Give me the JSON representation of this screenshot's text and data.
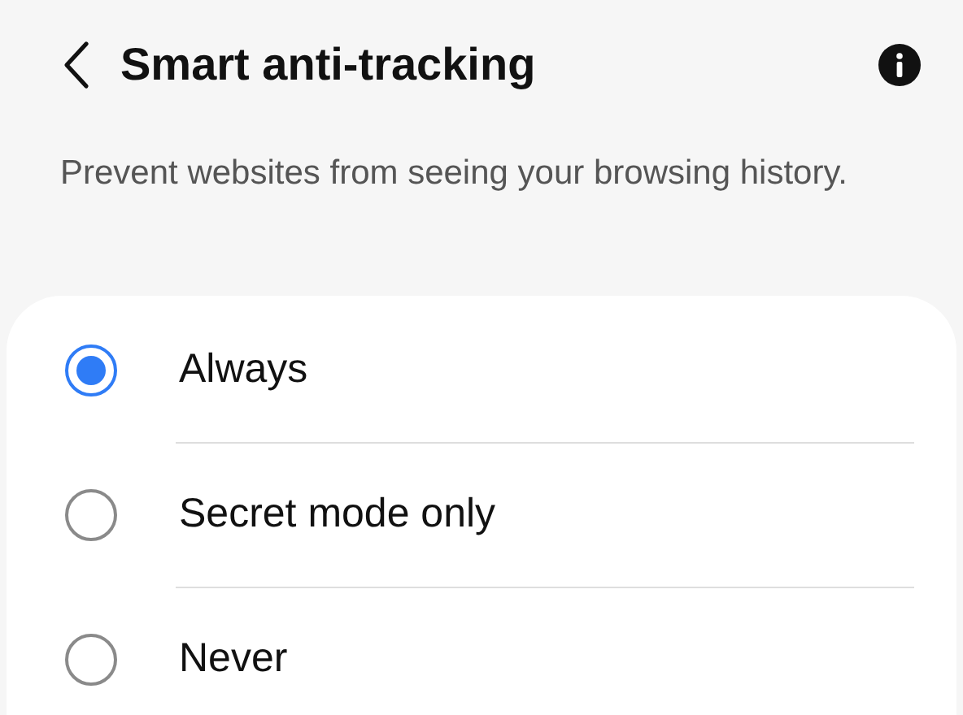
{
  "header": {
    "title": "Smart anti-tracking"
  },
  "description": "Prevent websites from seeing your browsing history.",
  "options": [
    {
      "label": "Always",
      "selected": true
    },
    {
      "label": "Secret mode only",
      "selected": false
    },
    {
      "label": "Never",
      "selected": false
    }
  ]
}
